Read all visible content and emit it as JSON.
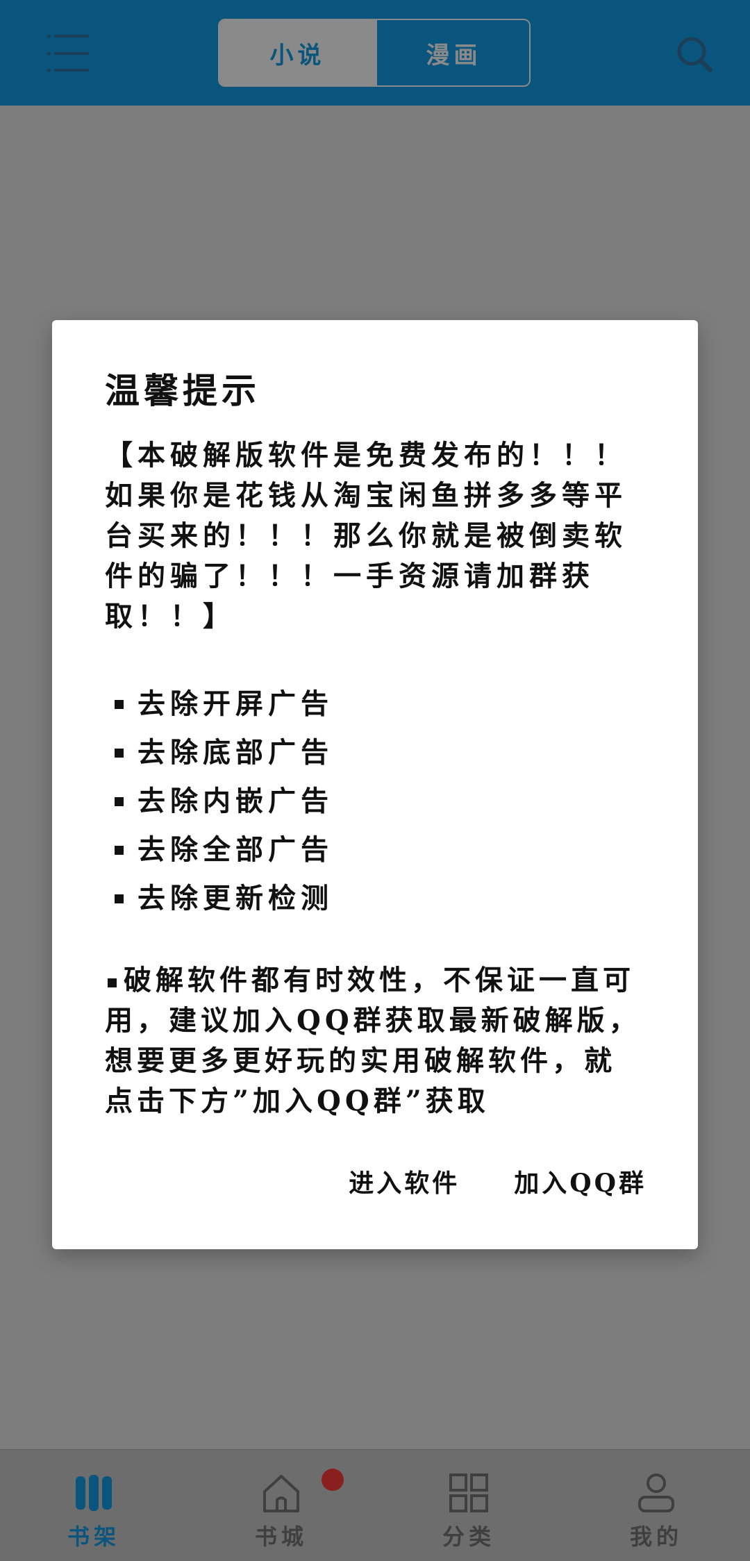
{
  "header": {
    "tabs": [
      {
        "label": "小说",
        "active": true
      },
      {
        "label": "漫画",
        "active": false
      }
    ],
    "icons": {
      "menu": "menu-icon",
      "search": "search-icon"
    },
    "colors": {
      "bar": "#0a557d",
      "segment_active": "#8a8a8a"
    }
  },
  "dialog": {
    "title": "温馨提示",
    "notice": "【本破解版软件是免费发布的！！！如果你是花钱从淘宝闲鱼拼多多等平台买来的！！！那么你就是被倒卖软件的骗了！！！一手资源请加群获取！！】",
    "features": [
      "去除开屏广告",
      "去除底部广告",
      "去除内嵌广告",
      "去除全部广告",
      "去除更新检测"
    ],
    "disclaimer": "破解软件都有时效性，不保证一直可用，建议加入QQ群获取最新破解版，想要更多更好玩的实用破解软件，就点击下方”加入QQ群”获取",
    "buttons": {
      "enter": "进入软件",
      "join": "加入QQ群"
    }
  },
  "bottom_nav": {
    "items": [
      {
        "label": "书架",
        "icon": "bookshelf-icon",
        "active": true
      },
      {
        "label": "书城",
        "icon": "home-icon",
        "active": false,
        "badge": true
      },
      {
        "label": "分类",
        "icon": "grid-icon",
        "active": false
      },
      {
        "label": "我的",
        "icon": "user-icon",
        "active": false
      }
    ],
    "colors": {
      "active": "#0a557d",
      "badge": "#8a1f1f"
    }
  }
}
